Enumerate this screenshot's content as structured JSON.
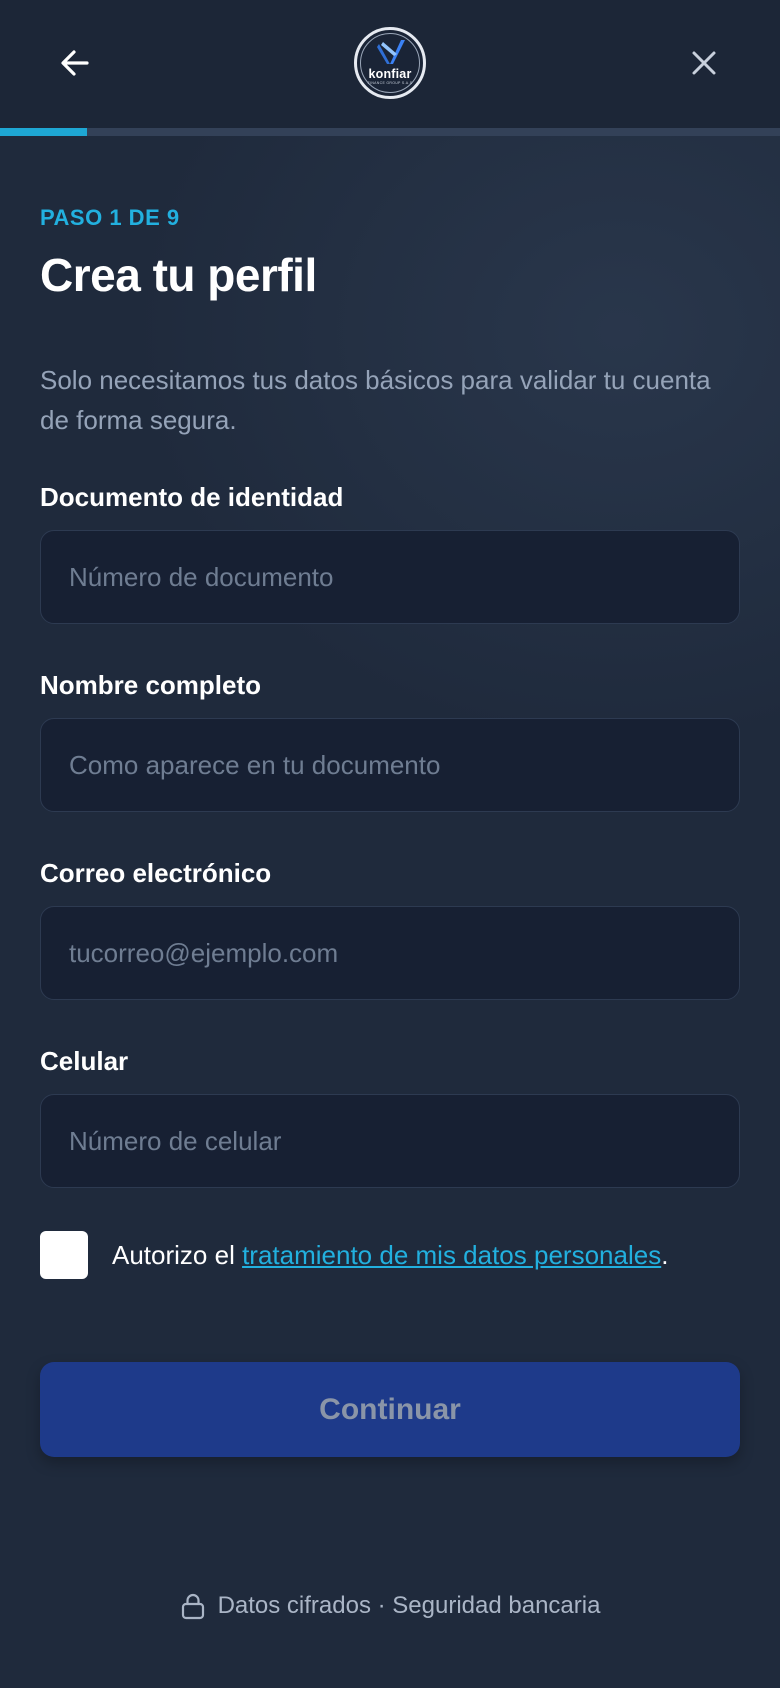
{
  "header": {
    "back_icon": "arrow-left-icon",
    "close_icon": "close-icon",
    "logo": {
      "name": "konfiar",
      "subtitle": "FINANCE GROUP S.A.S"
    }
  },
  "progress": {
    "current_step": 1,
    "total_steps": 9,
    "fraction": 0.111
  },
  "step_label": "PASO 1 DE 9",
  "title": "Crea tu perfil",
  "subtitle": "Solo necesitamos tus datos básicos para validar tu cuenta de forma segura.",
  "fields": [
    {
      "label": "Documento de identidad",
      "placeholder": "Número de documento",
      "value": ""
    },
    {
      "label": "Nombre completo",
      "placeholder": "Como aparece en tu documento",
      "value": ""
    },
    {
      "label": "Correo electrónico",
      "placeholder": "tucorreo@ejemplo.com",
      "value": ""
    },
    {
      "label": "Celular",
      "placeholder": "Número de celular",
      "value": ""
    }
  ],
  "consent": {
    "checked": false,
    "prefix": "Autorizo el ",
    "link_text": "tratamiento de mis datos personales",
    "suffix": "."
  },
  "continue_label": "Continuar",
  "footer": {
    "icon": "lock-icon",
    "text": "Datos cifrados · Seguridad bancaria"
  },
  "colors": {
    "background": "#1f2a3c",
    "accent": "#22b0df",
    "button": "#1e3a8a",
    "input_bg": "#172033"
  }
}
